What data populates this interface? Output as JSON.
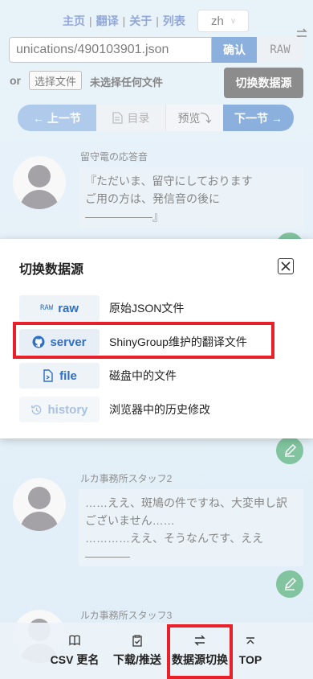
{
  "top_nav": {
    "links": [
      "主页",
      "翻译",
      "关于",
      "列表"
    ],
    "separator": "|",
    "lang_value": "zh"
  },
  "url_bar": {
    "value": "unications/490103901.json",
    "confirm_label": "确认",
    "raw_label": "RAW"
  },
  "file_row": {
    "or_label": "or",
    "choose_file_label": "选择文件",
    "no_file_label": "未选择任何文件"
  },
  "tooltip": "切换数据源",
  "chapter_nav": {
    "prev_label": "← 上一节",
    "index_label": "目录",
    "preview_label": "预览⤵",
    "next_label": "下一节 →"
  },
  "entries": [
    {
      "speaker": "留守電の応答音",
      "text": "『ただいま、留守にしております\nご用の方は、発信音の後に\n――――――』"
    },
    {
      "speaker": "ルカ事務所スタッフ2",
      "text": "……ええ、斑鳩の件ですね、大変申し訳ございません……\n…………ええ、そうなんです、ええ\n――――"
    },
    {
      "speaker": "ルカ事務所スタッフ3",
      "text": ""
    }
  ],
  "modal": {
    "title": "切换数据源",
    "options": [
      {
        "key": "raw",
        "icon": "raw-icon",
        "icon_text": "RAW",
        "label": "raw",
        "desc": "原始JSON文件"
      },
      {
        "key": "server",
        "icon": "github-icon",
        "label": "server",
        "desc": "ShinyGroup维护的翻译文件"
      },
      {
        "key": "file",
        "icon": "file-icon",
        "label": "file",
        "desc": "磁盘中的文件"
      },
      {
        "key": "history",
        "icon": "history-icon",
        "label": "history",
        "desc": "浏览器中的历史修改"
      }
    ]
  },
  "bottom_bar": {
    "items": [
      {
        "icon": "book-icon",
        "label": "CSV 更名"
      },
      {
        "icon": "clipboard-icon",
        "label": "下载/推送"
      },
      {
        "icon": "swap-icon",
        "label": "数据源切换"
      },
      {
        "icon": "top-icon",
        "label": "TOP"
      }
    ]
  },
  "colors": {
    "primary": "#2f6fc4",
    "highlight": "#e8202a",
    "fab_green": "#1a9450"
  }
}
